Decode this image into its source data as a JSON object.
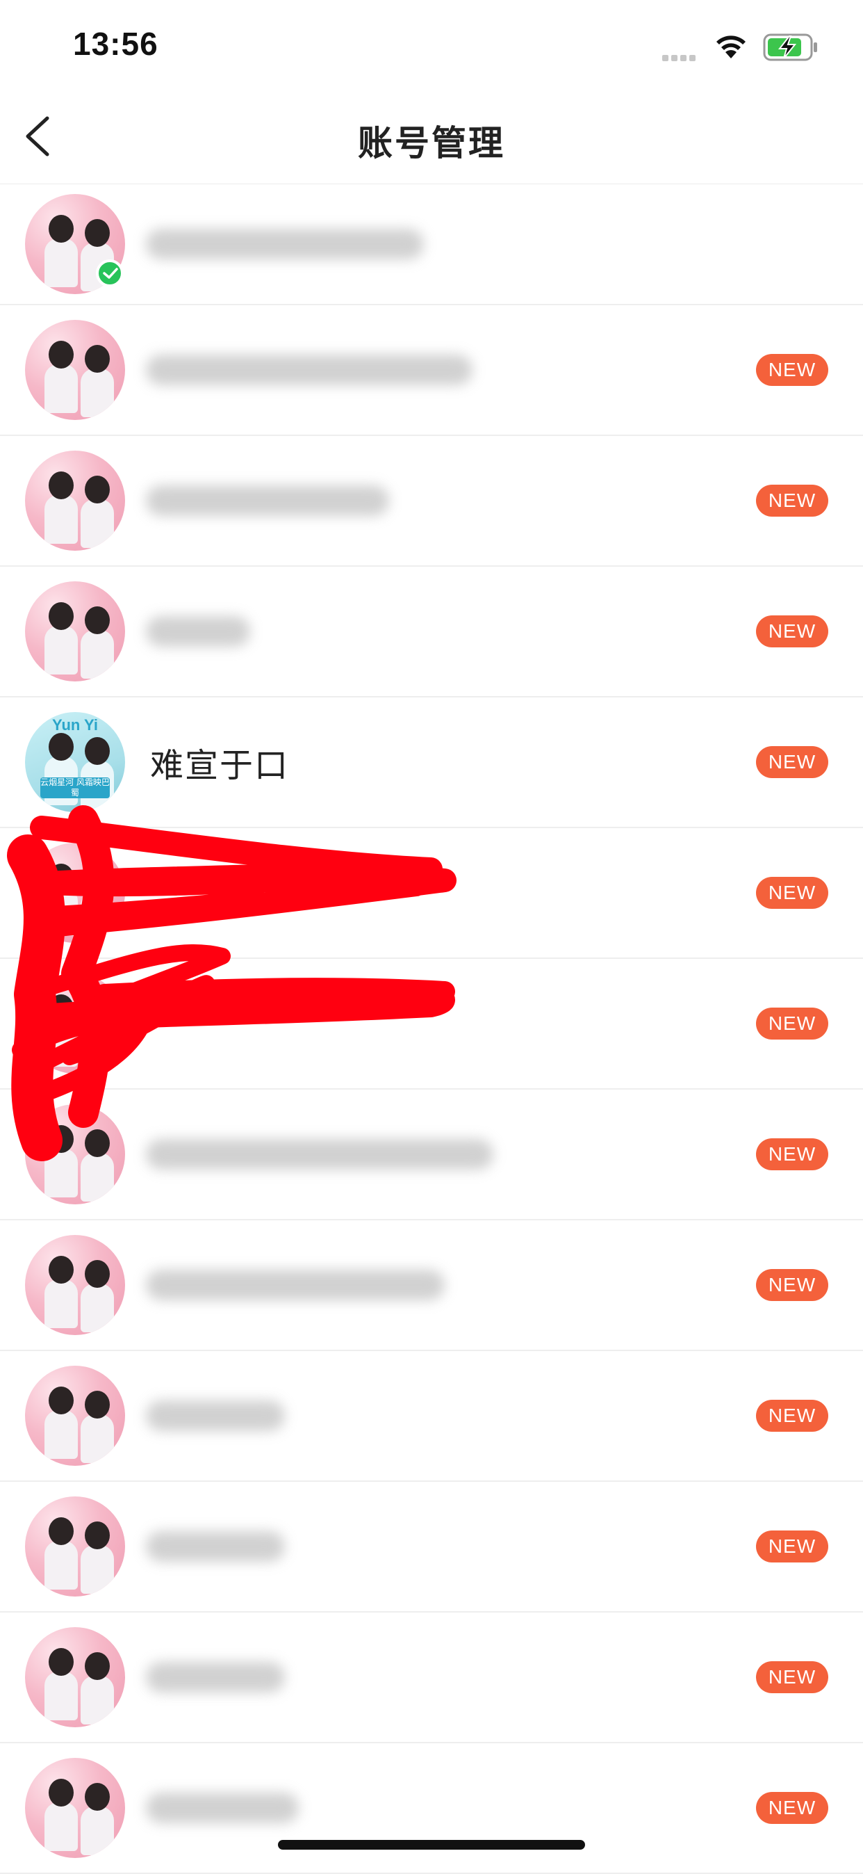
{
  "status_bar": {
    "time": "13:56"
  },
  "nav": {
    "title": "账号管理"
  },
  "accounts": [
    {
      "name": "",
      "current": true,
      "badge": "",
      "blur_width": 400
    },
    {
      "name": "",
      "badge": "NEW",
      "blur_width": 470
    },
    {
      "name": "",
      "badge": "NEW",
      "blur_width": 350
    },
    {
      "name": "",
      "badge": "NEW",
      "blur_width": 150
    },
    {
      "name": "难宣于口",
      "badge": "NEW",
      "avatar_style": "alt",
      "avatar_top": "Yun Yi",
      "avatar_caption": "云烟星河 风霜映巴蜀"
    },
    {
      "name": "",
      "badge": "NEW",
      "redacted": true
    },
    {
      "name": "",
      "badge": "NEW",
      "redacted": true
    },
    {
      "name": "",
      "badge": "NEW",
      "blur_width": 500
    },
    {
      "name": "",
      "badge": "NEW",
      "blur_width": 430
    },
    {
      "name": "",
      "badge": "NEW",
      "blur_width": 200
    },
    {
      "name": "",
      "badge": "NEW",
      "blur_width": 200
    },
    {
      "name": "",
      "badge": "NEW",
      "blur_width": 200
    },
    {
      "name": "",
      "badge": "NEW",
      "blur_width": 220
    }
  ],
  "colors": {
    "new_badge": "#f4613b",
    "check_badge": "#28c35a",
    "redaction": "#ff0010"
  }
}
